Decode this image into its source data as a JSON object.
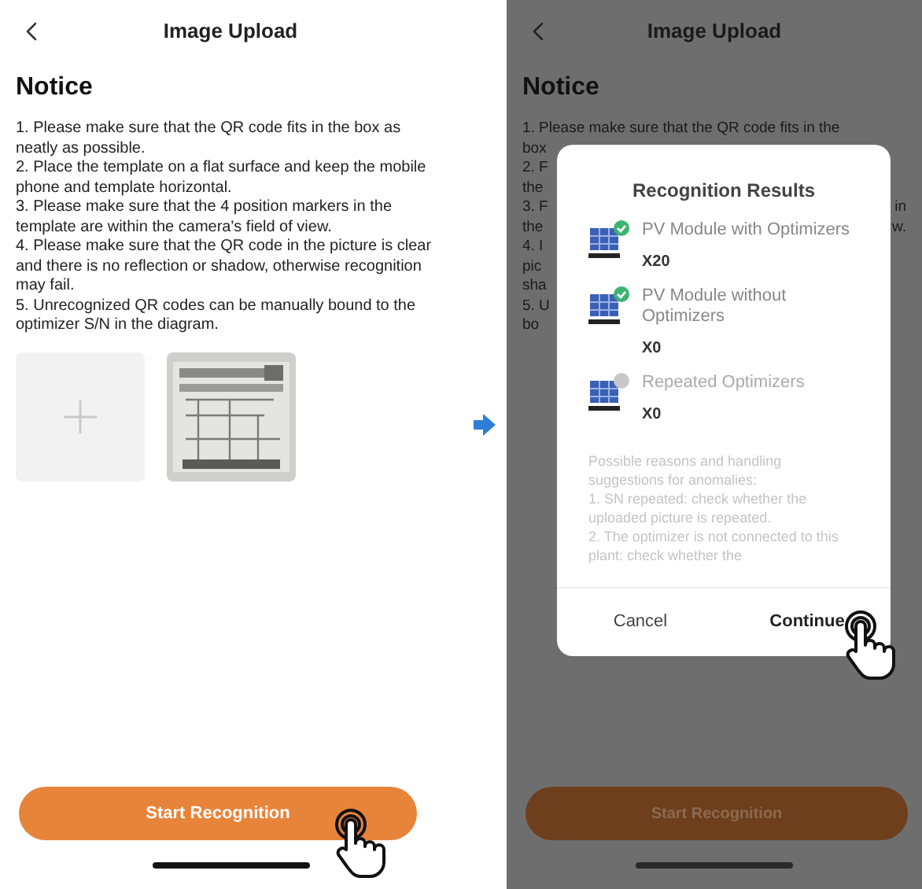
{
  "left_screen": {
    "title": "Image Upload",
    "notice_heading": "Notice",
    "notice_items": [
      "1. Please make sure that the QR code fits in the box as neatly as possible.",
      "2. Place the template on a flat surface and keep the mobile phone and template horizontal.",
      "3. Please make sure that the 4 position markers in the template are within the camera's field of view.",
      "4. Please make sure that the QR code in the picture is clear and there is no reflection or shadow, otherwise recognition may fail.",
      "5. Unrecognized QR codes can be manually bound to the optimizer S/N in the diagram."
    ],
    "upload_tiles": [
      {
        "kind": "add"
      },
      {
        "kind": "picture"
      }
    ],
    "start_button": "Start Recognition"
  },
  "right_screen": {
    "title": "Image Upload",
    "notice_heading": "Notice",
    "notice_first_line": "1. Please make sure that the QR code fits in the",
    "notice_fragments": [
      {
        "left": "box"
      },
      {
        "left": "2. F"
      },
      {
        "left": "the"
      },
      {
        "left": "3. F",
        "right": "in"
      },
      {
        "left": "the",
        "right": "w."
      },
      {
        "left": "4. I"
      },
      {
        "left": "pic"
      },
      {
        "left": "sha"
      },
      {
        "left": "5. U"
      },
      {
        "left": "bo"
      }
    ],
    "dialog": {
      "title": "Recognition Results",
      "results": [
        {
          "label": "PV Module with Optimizers",
          "count": "X20",
          "checked": true
        },
        {
          "label": "PV Module without Optimizers",
          "count": "X0",
          "checked": true
        },
        {
          "label": "Repeated Optimizers",
          "count": "X0",
          "checked": false
        }
      ],
      "note": "Possible reasons and handling suggestions for anomalies:\n1. SN repeated: check whether the uploaded picture is repeated.\n2. The optimizer is not connected to this plant: check whether the",
      "buttons": [
        "Cancel",
        "Continue"
      ]
    },
    "start_button": "Start Recognition"
  }
}
